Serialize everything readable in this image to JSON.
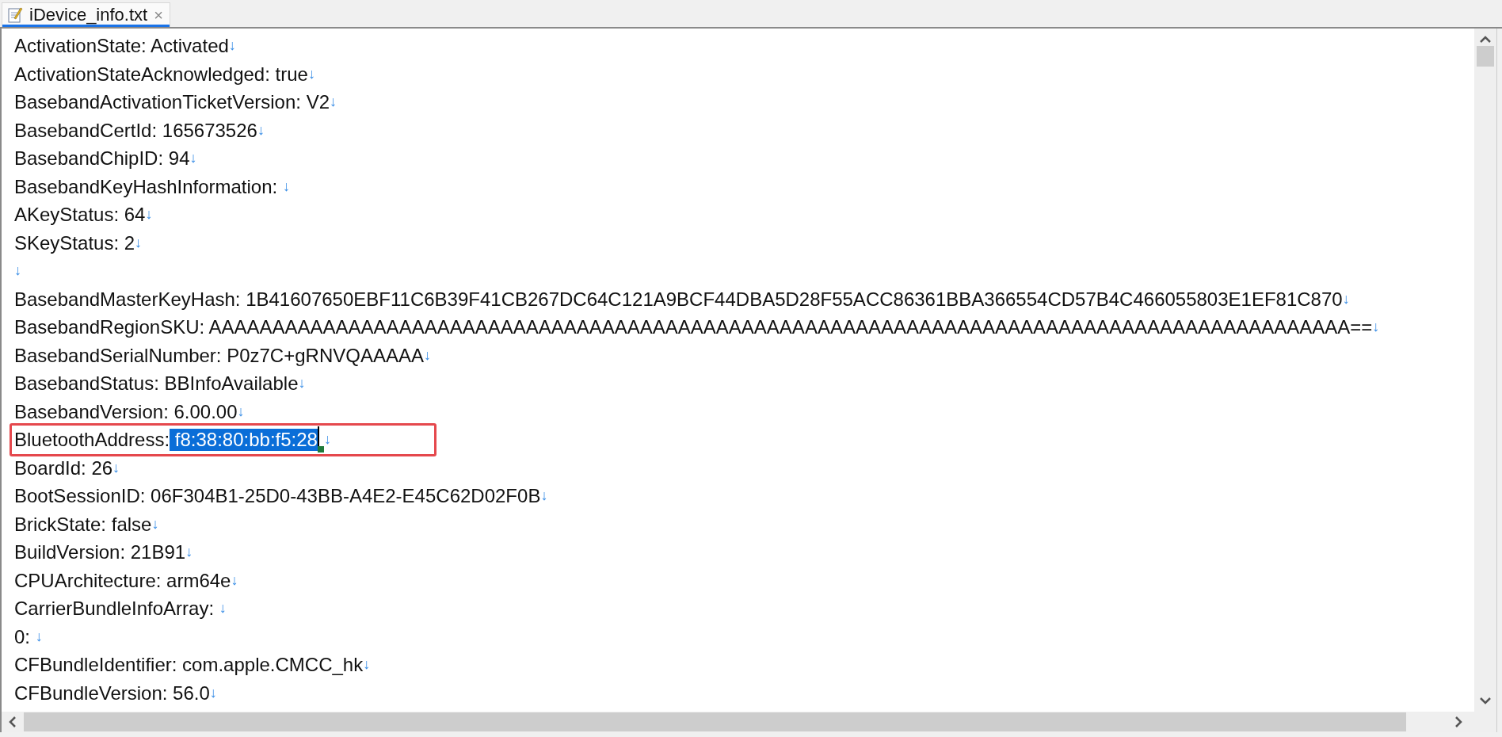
{
  "tabs": [
    {
      "label": "iDevice_info.txt",
      "selected": true,
      "close": "×"
    }
  ],
  "lines": [
    {
      "text": "ActivationState: Activated",
      "mark": "↓",
      "highlighted": false
    },
    {
      "text": "ActivationStateAcknowledged: true",
      "mark": "↓",
      "highlighted": false
    },
    {
      "text": "BasebandActivationTicketVersion: V2",
      "mark": "↓",
      "highlighted": false
    },
    {
      "text": "BasebandCertId: 165673526",
      "mark": "↓",
      "highlighted": false
    },
    {
      "text": "BasebandChipID: 94",
      "mark": "↓",
      "highlighted": false
    },
    {
      "text": "BasebandKeyHashInformation: ",
      "mark": "↓",
      "highlighted": false
    },
    {
      "text": "AKeyStatus: 64",
      "mark": "↓",
      "highlighted": false
    },
    {
      "text": "SKeyStatus: 2",
      "mark": "↓",
      "highlighted": false
    },
    {
      "mark": "↓",
      "highlighted": false
    },
    {
      "text": "BasebandMasterKeyHash: 1B41607650EBF11C6B39F41CB267DC64C121A9BCF44DBA5D28F55ACC86361BBA366554CD57B4C466055803E1EF81C870",
      "mark": "↓",
      "highlighted": false
    },
    {
      "text": "BasebandRegionSKU: AAAAAAAAAAAAAAAAAAAAAAAAAAAAAAAAAAAAAAAAAAAAAAAAAAAAAAAAAAAAAAAAAAAAAAAAAAAAAAAAAAAAAAAAAA==",
      "mark": "↓",
      "highlighted": false
    },
    {
      "text": "BasebandSerialNumber: P0z7C+gRNVQAAAAA",
      "mark": "↓",
      "highlighted": false
    },
    {
      "text": "BasebandStatus: BBInfoAvailable",
      "mark": "↓",
      "highlighted": false
    },
    {
      "text": "BasebandVersion: 6.00.00",
      "mark": "↓",
      "highlighted": false
    },
    {
      "text": "BluetoothAddress:",
      "selected_text": " f8:38:80:bb:f5:28",
      "mark": "↓",
      "highlighted": true
    },
    {
      "text": "BoardId: 26",
      "mark": "↓",
      "highlighted": false
    },
    {
      "text": "BootSessionID: 06F304B1-25D0-43BB-A4E2-E45C62D02F0B",
      "mark": "↓",
      "highlighted": false
    },
    {
      "text": "BrickState: false",
      "mark": "↓",
      "highlighted": false
    },
    {
      "text": "BuildVersion: 21B91",
      "mark": "↓",
      "highlighted": false
    },
    {
      "text": "CPUArchitecture: arm64e",
      "mark": "↓",
      "highlighted": false
    },
    {
      "text": "CarrierBundleInfoArray: ",
      "mark": "↓",
      "highlighted": false
    },
    {
      "text": "0: ",
      "mark": "↓",
      "highlighted": false
    },
    {
      "text": "CFBundleIdentifier: com.apple.CMCC_hk",
      "mark": "↓",
      "highlighted": false
    },
    {
      "text": "CFBundleVersion: 56.0",
      "mark": "↓",
      "highlighted": false
    }
  ]
}
